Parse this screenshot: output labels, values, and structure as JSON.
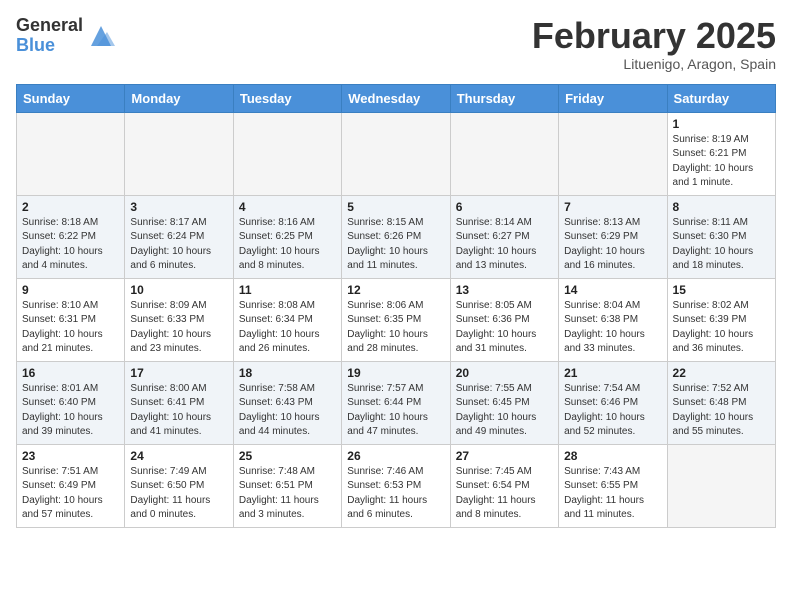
{
  "header": {
    "logo": {
      "general": "General",
      "blue": "Blue"
    },
    "title": "February 2025",
    "subtitle": "Lituenigo, Aragon, Spain"
  },
  "weekdays": [
    "Sunday",
    "Monday",
    "Tuesday",
    "Wednesday",
    "Thursday",
    "Friday",
    "Saturday"
  ],
  "weeks": [
    [
      {
        "day": "",
        "info": ""
      },
      {
        "day": "",
        "info": ""
      },
      {
        "day": "",
        "info": ""
      },
      {
        "day": "",
        "info": ""
      },
      {
        "day": "",
        "info": ""
      },
      {
        "day": "",
        "info": ""
      },
      {
        "day": "1",
        "info": "Sunrise: 8:19 AM\nSunset: 6:21 PM\nDaylight: 10 hours\nand 1 minute."
      }
    ],
    [
      {
        "day": "2",
        "info": "Sunrise: 8:18 AM\nSunset: 6:22 PM\nDaylight: 10 hours\nand 4 minutes."
      },
      {
        "day": "3",
        "info": "Sunrise: 8:17 AM\nSunset: 6:24 PM\nDaylight: 10 hours\nand 6 minutes."
      },
      {
        "day": "4",
        "info": "Sunrise: 8:16 AM\nSunset: 6:25 PM\nDaylight: 10 hours\nand 8 minutes."
      },
      {
        "day": "5",
        "info": "Sunrise: 8:15 AM\nSunset: 6:26 PM\nDaylight: 10 hours\nand 11 minutes."
      },
      {
        "day": "6",
        "info": "Sunrise: 8:14 AM\nSunset: 6:27 PM\nDaylight: 10 hours\nand 13 minutes."
      },
      {
        "day": "7",
        "info": "Sunrise: 8:13 AM\nSunset: 6:29 PM\nDaylight: 10 hours\nand 16 minutes."
      },
      {
        "day": "8",
        "info": "Sunrise: 8:11 AM\nSunset: 6:30 PM\nDaylight: 10 hours\nand 18 minutes."
      }
    ],
    [
      {
        "day": "9",
        "info": "Sunrise: 8:10 AM\nSunset: 6:31 PM\nDaylight: 10 hours\nand 21 minutes."
      },
      {
        "day": "10",
        "info": "Sunrise: 8:09 AM\nSunset: 6:33 PM\nDaylight: 10 hours\nand 23 minutes."
      },
      {
        "day": "11",
        "info": "Sunrise: 8:08 AM\nSunset: 6:34 PM\nDaylight: 10 hours\nand 26 minutes."
      },
      {
        "day": "12",
        "info": "Sunrise: 8:06 AM\nSunset: 6:35 PM\nDaylight: 10 hours\nand 28 minutes."
      },
      {
        "day": "13",
        "info": "Sunrise: 8:05 AM\nSunset: 6:36 PM\nDaylight: 10 hours\nand 31 minutes."
      },
      {
        "day": "14",
        "info": "Sunrise: 8:04 AM\nSunset: 6:38 PM\nDaylight: 10 hours\nand 33 minutes."
      },
      {
        "day": "15",
        "info": "Sunrise: 8:02 AM\nSunset: 6:39 PM\nDaylight: 10 hours\nand 36 minutes."
      }
    ],
    [
      {
        "day": "16",
        "info": "Sunrise: 8:01 AM\nSunset: 6:40 PM\nDaylight: 10 hours\nand 39 minutes."
      },
      {
        "day": "17",
        "info": "Sunrise: 8:00 AM\nSunset: 6:41 PM\nDaylight: 10 hours\nand 41 minutes."
      },
      {
        "day": "18",
        "info": "Sunrise: 7:58 AM\nSunset: 6:43 PM\nDaylight: 10 hours\nand 44 minutes."
      },
      {
        "day": "19",
        "info": "Sunrise: 7:57 AM\nSunset: 6:44 PM\nDaylight: 10 hours\nand 47 minutes."
      },
      {
        "day": "20",
        "info": "Sunrise: 7:55 AM\nSunset: 6:45 PM\nDaylight: 10 hours\nand 49 minutes."
      },
      {
        "day": "21",
        "info": "Sunrise: 7:54 AM\nSunset: 6:46 PM\nDaylight: 10 hours\nand 52 minutes."
      },
      {
        "day": "22",
        "info": "Sunrise: 7:52 AM\nSunset: 6:48 PM\nDaylight: 10 hours\nand 55 minutes."
      }
    ],
    [
      {
        "day": "23",
        "info": "Sunrise: 7:51 AM\nSunset: 6:49 PM\nDaylight: 10 hours\nand 57 minutes."
      },
      {
        "day": "24",
        "info": "Sunrise: 7:49 AM\nSunset: 6:50 PM\nDaylight: 11 hours\nand 0 minutes."
      },
      {
        "day": "25",
        "info": "Sunrise: 7:48 AM\nSunset: 6:51 PM\nDaylight: 11 hours\nand 3 minutes."
      },
      {
        "day": "26",
        "info": "Sunrise: 7:46 AM\nSunset: 6:53 PM\nDaylight: 11 hours\nand 6 minutes."
      },
      {
        "day": "27",
        "info": "Sunrise: 7:45 AM\nSunset: 6:54 PM\nDaylight: 11 hours\nand 8 minutes."
      },
      {
        "day": "28",
        "info": "Sunrise: 7:43 AM\nSunset: 6:55 PM\nDaylight: 11 hours\nand 11 minutes."
      },
      {
        "day": "",
        "info": ""
      }
    ]
  ]
}
